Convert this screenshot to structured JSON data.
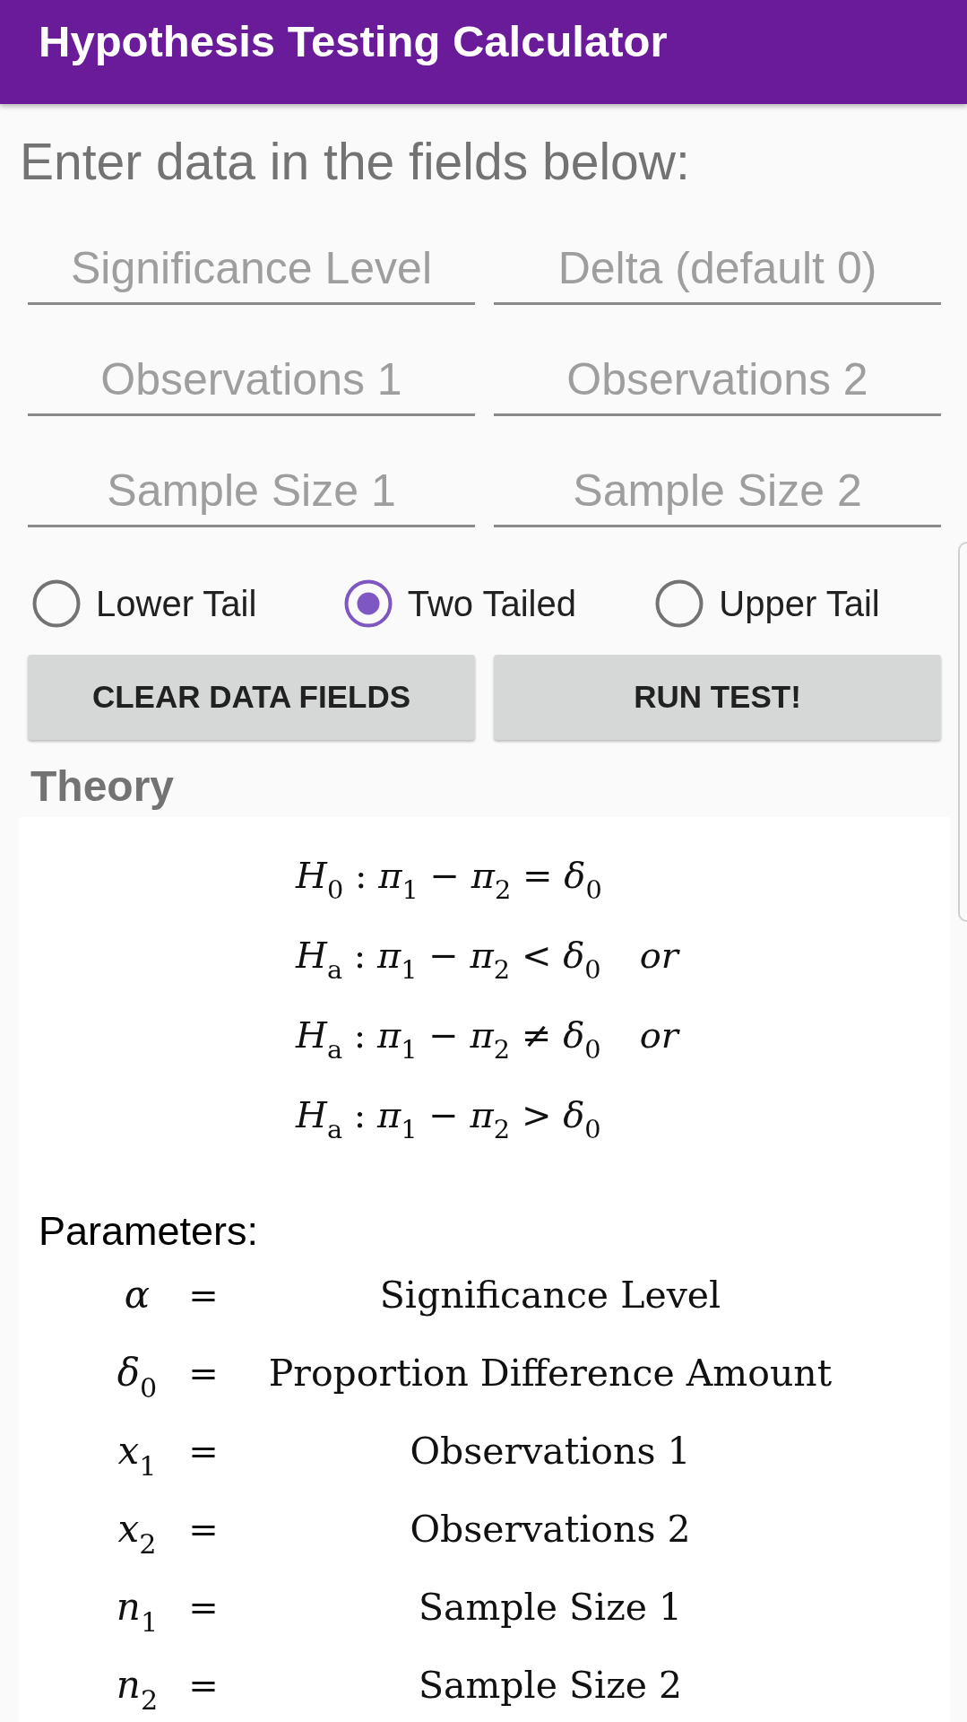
{
  "app_bar": {
    "title": "Hypothesis Testing Calculator"
  },
  "instructions": "Enter data in the fields below:",
  "fields": [
    {
      "placeholder": "Significance Level"
    },
    {
      "placeholder": "Delta (default 0)"
    },
    {
      "placeholder": "Observations 1"
    },
    {
      "placeholder": "Observations 2"
    },
    {
      "placeholder": "Sample Size 1"
    },
    {
      "placeholder": "Sample Size 2"
    }
  ],
  "tail_options": [
    {
      "label": "Lower Tail",
      "selected": false
    },
    {
      "label": "Two Tailed",
      "selected": true
    },
    {
      "label": "Upper Tail",
      "selected": false
    }
  ],
  "buttons": [
    {
      "label": "CLEAR DATA FIELDS"
    },
    {
      "label": "RUN TEST!"
    }
  ],
  "theory": {
    "heading": "Theory",
    "hypotheses": [
      {
        "formula": "*H*$_{0}$ : *π*$_{1}$ − *π*$_{2}$ = *δ*$_{0}$"
      },
      {
        "formula": "*H*$_{a}$ : *π*$_{1}$ − *π*$_{2}$ < *δ*$_{0}$",
        "suffix": "or"
      },
      {
        "formula": "*H*$_{a}$ : *π*$_{1}$ − *π*$_{2}$ ≠ *δ*$_{0}$",
        "suffix": "or"
      },
      {
        "formula": "*H*$_{a}$ : *π*$_{1}$ − *π*$_{2}$ > *δ*$_{0}$"
      }
    ],
    "parameters_label": "Parameters:",
    "parameters": [
      {
        "symbol": "α",
        "equals": "=",
        "meaning": "Significance Level"
      },
      {
        "symbol": "δ$_{0}$",
        "equals": "=",
        "meaning": "Proportion Difference Amount"
      },
      {
        "symbol": "x$_{1}$",
        "equals": "=",
        "meaning": "Observations 1"
      },
      {
        "symbol": "x$_{2}$",
        "equals": "=",
        "meaning": "Observations 2"
      },
      {
        "symbol": "n$_{1}$",
        "equals": "=",
        "meaning": "Sample Size 1"
      },
      {
        "symbol": "n$_{2}$",
        "equals": "=",
        "meaning": "Sample Size 2"
      }
    ]
  }
}
